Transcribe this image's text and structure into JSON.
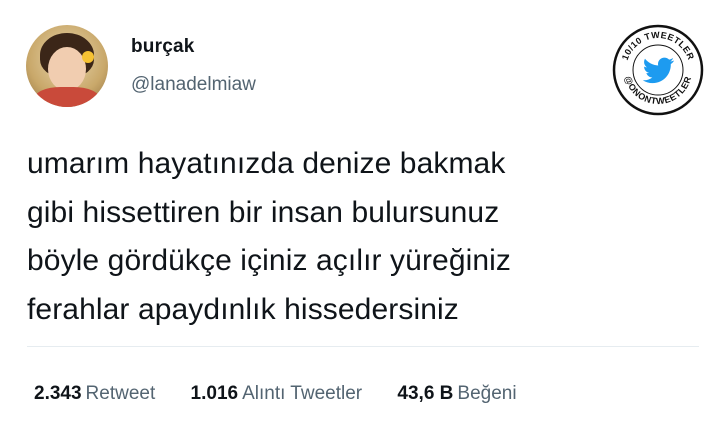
{
  "author": {
    "name": "burçak",
    "handle": "@lanadelmiaw"
  },
  "badge": {
    "text_top": "10/10 TWEETLER",
    "text_bottom": "@ONONTWEETLER",
    "icon": "twitter-bird-icon",
    "bird_color": "#1d9bf0"
  },
  "tweet": {
    "lines": [
      "umarım hayatınızda denize bakmak",
      "gibi hissettiren bir insan bulursunuz",
      "böyle gördükçe içiniz açılır yüreğiniz",
      "ferahlar apaydınlık hissedersiniz"
    ]
  },
  "stats": [
    {
      "count": "2.343",
      "label": "Retweet"
    },
    {
      "count": "1.016",
      "label": "Alıntı Tweetler"
    },
    {
      "count": "43,6 B",
      "label": "Beğeni"
    }
  ]
}
